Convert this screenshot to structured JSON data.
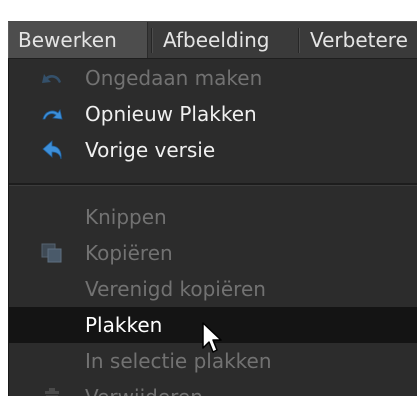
{
  "menubar": {
    "items": [
      {
        "label": "Bewerken",
        "active": true
      },
      {
        "label": "Afbeelding"
      },
      {
        "label": "Verbetere"
      }
    ]
  },
  "dropdown": {
    "items": [
      {
        "label": "Ongedaan maken",
        "enabled": false,
        "icon": "undo-icon"
      },
      {
        "label": "Opnieuw Plakken",
        "enabled": true,
        "icon": "redo-icon"
      },
      {
        "label": "Vorige versie",
        "enabled": true,
        "icon": "revert-icon"
      },
      {
        "label": "Knippen",
        "enabled": false
      },
      {
        "label": "Kopiëren",
        "enabled": false,
        "icon": "copy-icon"
      },
      {
        "label": "Verenigd kopiëren",
        "enabled": false
      },
      {
        "label": "Plakken",
        "enabled": true,
        "highlighted": true
      },
      {
        "label": "In selectie plakken",
        "enabled": false
      },
      {
        "label": "Verwijderen",
        "enabled": false,
        "icon": "trash-icon"
      }
    ]
  },
  "colors": {
    "menubar_bg": "#3a3a3a",
    "dropdown_bg": "#2c2c2c",
    "highlight_bg": "#141414",
    "enabled_text": "#f0f0f0",
    "disabled_text": "#727272",
    "icon_blue": "#3d8fd9"
  }
}
